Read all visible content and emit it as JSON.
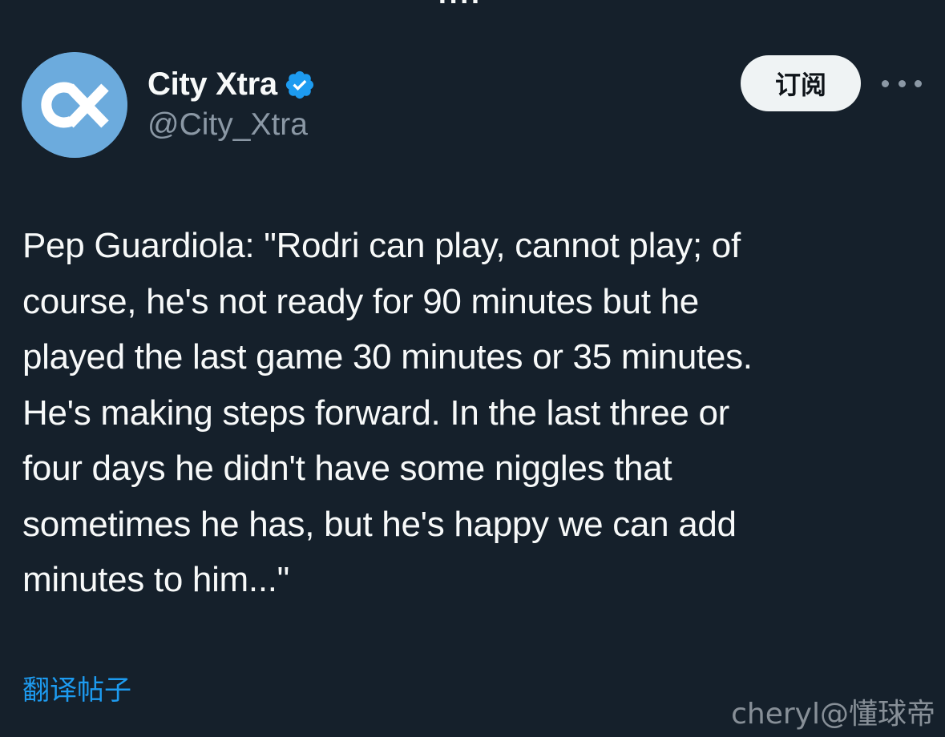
{
  "account": {
    "display_name": "City Xtra",
    "handle": "@City_Xtra",
    "verified": true,
    "avatar_bg_color": "#6cabdd",
    "avatar_icon": "cx-logo"
  },
  "header": {
    "subscribe_label": "订阅",
    "more_icon": "more-horizontal-icon"
  },
  "tweet": {
    "text": "Pep Guardiola: \"Rodri can play, cannot play; of\ncourse, he's not ready for 90 minutes but he\nplayed the last game 30 minutes or 35 minutes.\nHe's making steps forward. In the last three or\nfour days he didn't have some niggles that\nsometimes he has, but he's happy we can add\nminutes to him...\""
  },
  "translate": {
    "label": "翻译帖子"
  },
  "watermark": {
    "text": "cheryl@懂球帝"
  },
  "colors": {
    "background": "#15202b",
    "primary_text": "#f7f9f9",
    "secondary_text": "#8b98a5",
    "link": "#1d9bf0",
    "verified_badge": "#1d9bf0",
    "subscribe_bg": "#eff3f4"
  }
}
